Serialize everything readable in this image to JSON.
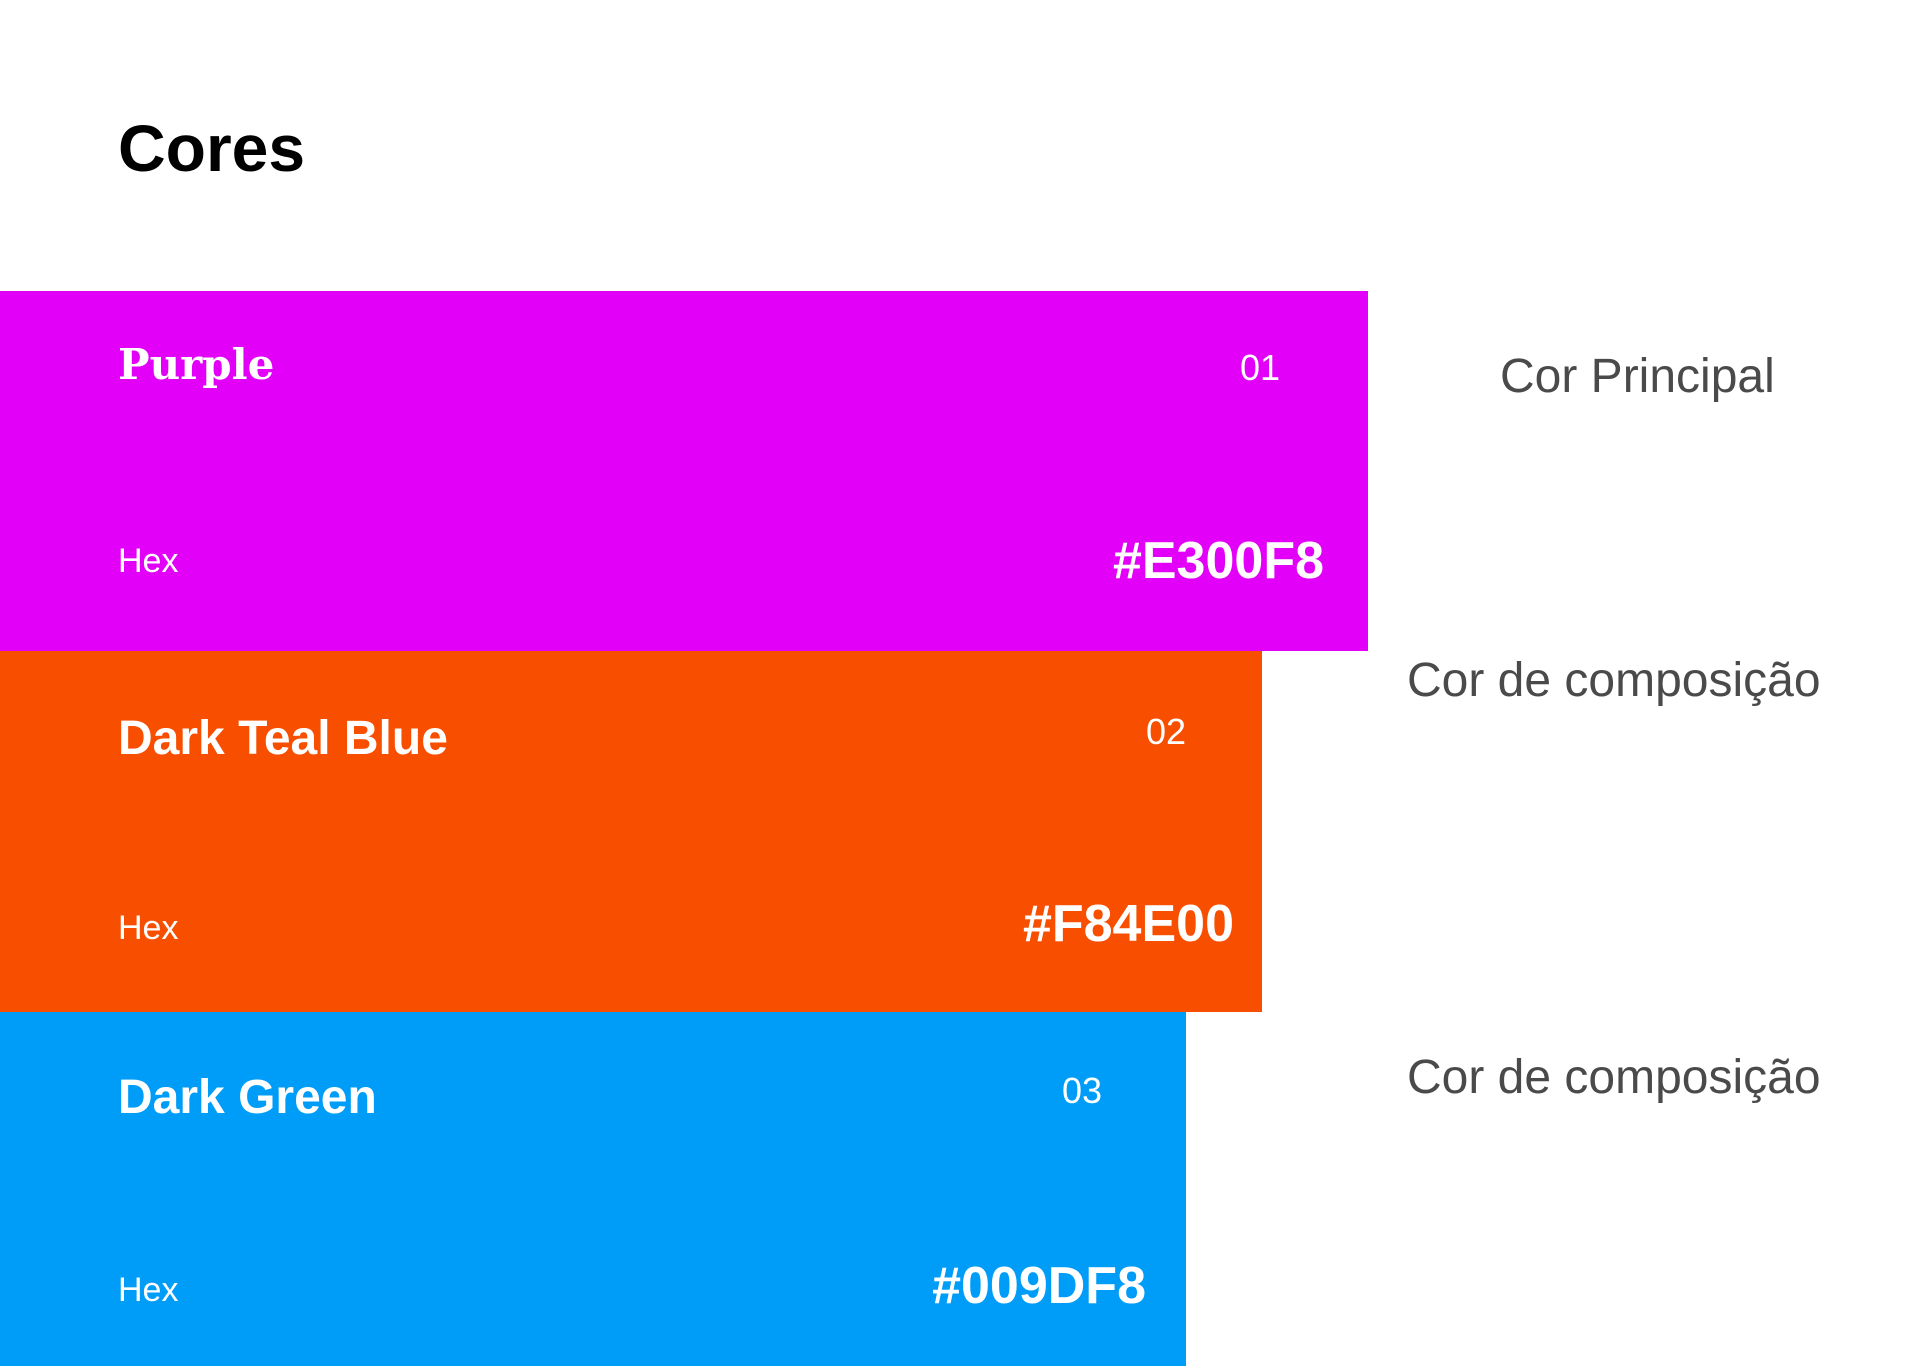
{
  "title": "Cores",
  "swatches": [
    {
      "name": "Purple",
      "number": "01",
      "hex_label": "Hex",
      "hex_value": "#E300F8",
      "color": "#E300F8",
      "side_label": "Cor Principal"
    },
    {
      "name": "Dark Teal Blue",
      "number": "02",
      "hex_label": "Hex",
      "hex_value": "#F84E00",
      "color": "#F84E00",
      "side_label": "Cor de composição"
    },
    {
      "name": "Dark Green",
      "number": "03",
      "hex_label": "Hex",
      "hex_value": "#009DF8",
      "color": "#009DF8",
      "side_label": "Cor de composição"
    }
  ]
}
